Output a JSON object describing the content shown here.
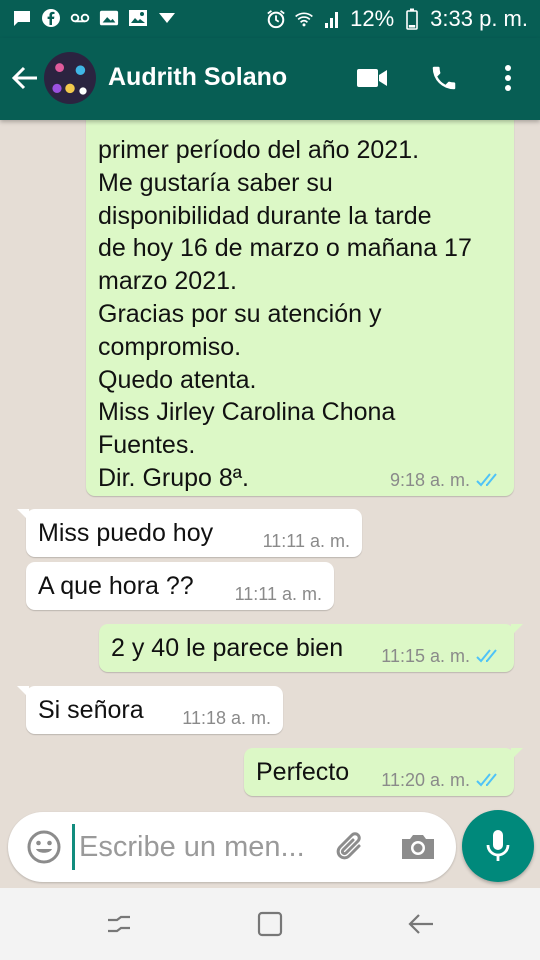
{
  "status_bar": {
    "battery": "12%",
    "time": "3:33 p. m.",
    "left_icons": [
      "message-notification-icon",
      "facebook-icon",
      "voicemail-icon",
      "photo-icon",
      "image-icon",
      "dropdown-icon"
    ],
    "right_icons": [
      "alarm-icon",
      "wifi-icon",
      "signal-icon",
      "battery-icon"
    ]
  },
  "header": {
    "contact_name": "Audrith Solano",
    "icons": [
      "back-arrow-icon",
      "video-call-icon",
      "phone-icon",
      "more-vert-icon"
    ]
  },
  "messages": [
    {
      "direction": "out",
      "lines": [
        "primer período del año 2021.",
        "Me gustaría saber su",
        "disponibilidad durante la tarde",
        "de hoy 16 de marzo o mañana 17",
        "marzo 2021.",
        "Gracias por su atención y",
        "compromiso.",
        "Quedo atenta.",
        "Miss Jirley Carolina Chona",
        "Fuentes.",
        "Dir. Grupo 8ª."
      ],
      "time": "9:18 a. m.",
      "read": true
    },
    {
      "direction": "in",
      "lines": [
        "Miss puedo hoy"
      ],
      "time": "11:11 a. m."
    },
    {
      "direction": "in",
      "lines": [
        "A que hora ??"
      ],
      "time": "11:11 a. m."
    },
    {
      "direction": "out",
      "lines": [
        "2 y 40 le parece bien"
      ],
      "time": "11:15 a. m.",
      "read": true
    },
    {
      "direction": "in",
      "lines": [
        "Si señora"
      ],
      "time": "11:18 a. m."
    },
    {
      "direction": "out",
      "lines": [
        "Perfecto"
      ],
      "time": "11:20 a. m.",
      "read": true
    }
  ],
  "composer": {
    "placeholder": "Escribe un men...",
    "icons": [
      "emoji-icon",
      "attach-icon",
      "camera-icon",
      "mic-icon"
    ]
  },
  "colors": {
    "toolbar": "#075e54",
    "outgoing_bubble": "#dcf8c6",
    "incoming_bubble": "#ffffff",
    "chat_background": "#e5ddd5",
    "read_ticks": "#4fc3f7",
    "mic_button": "#00897b"
  }
}
